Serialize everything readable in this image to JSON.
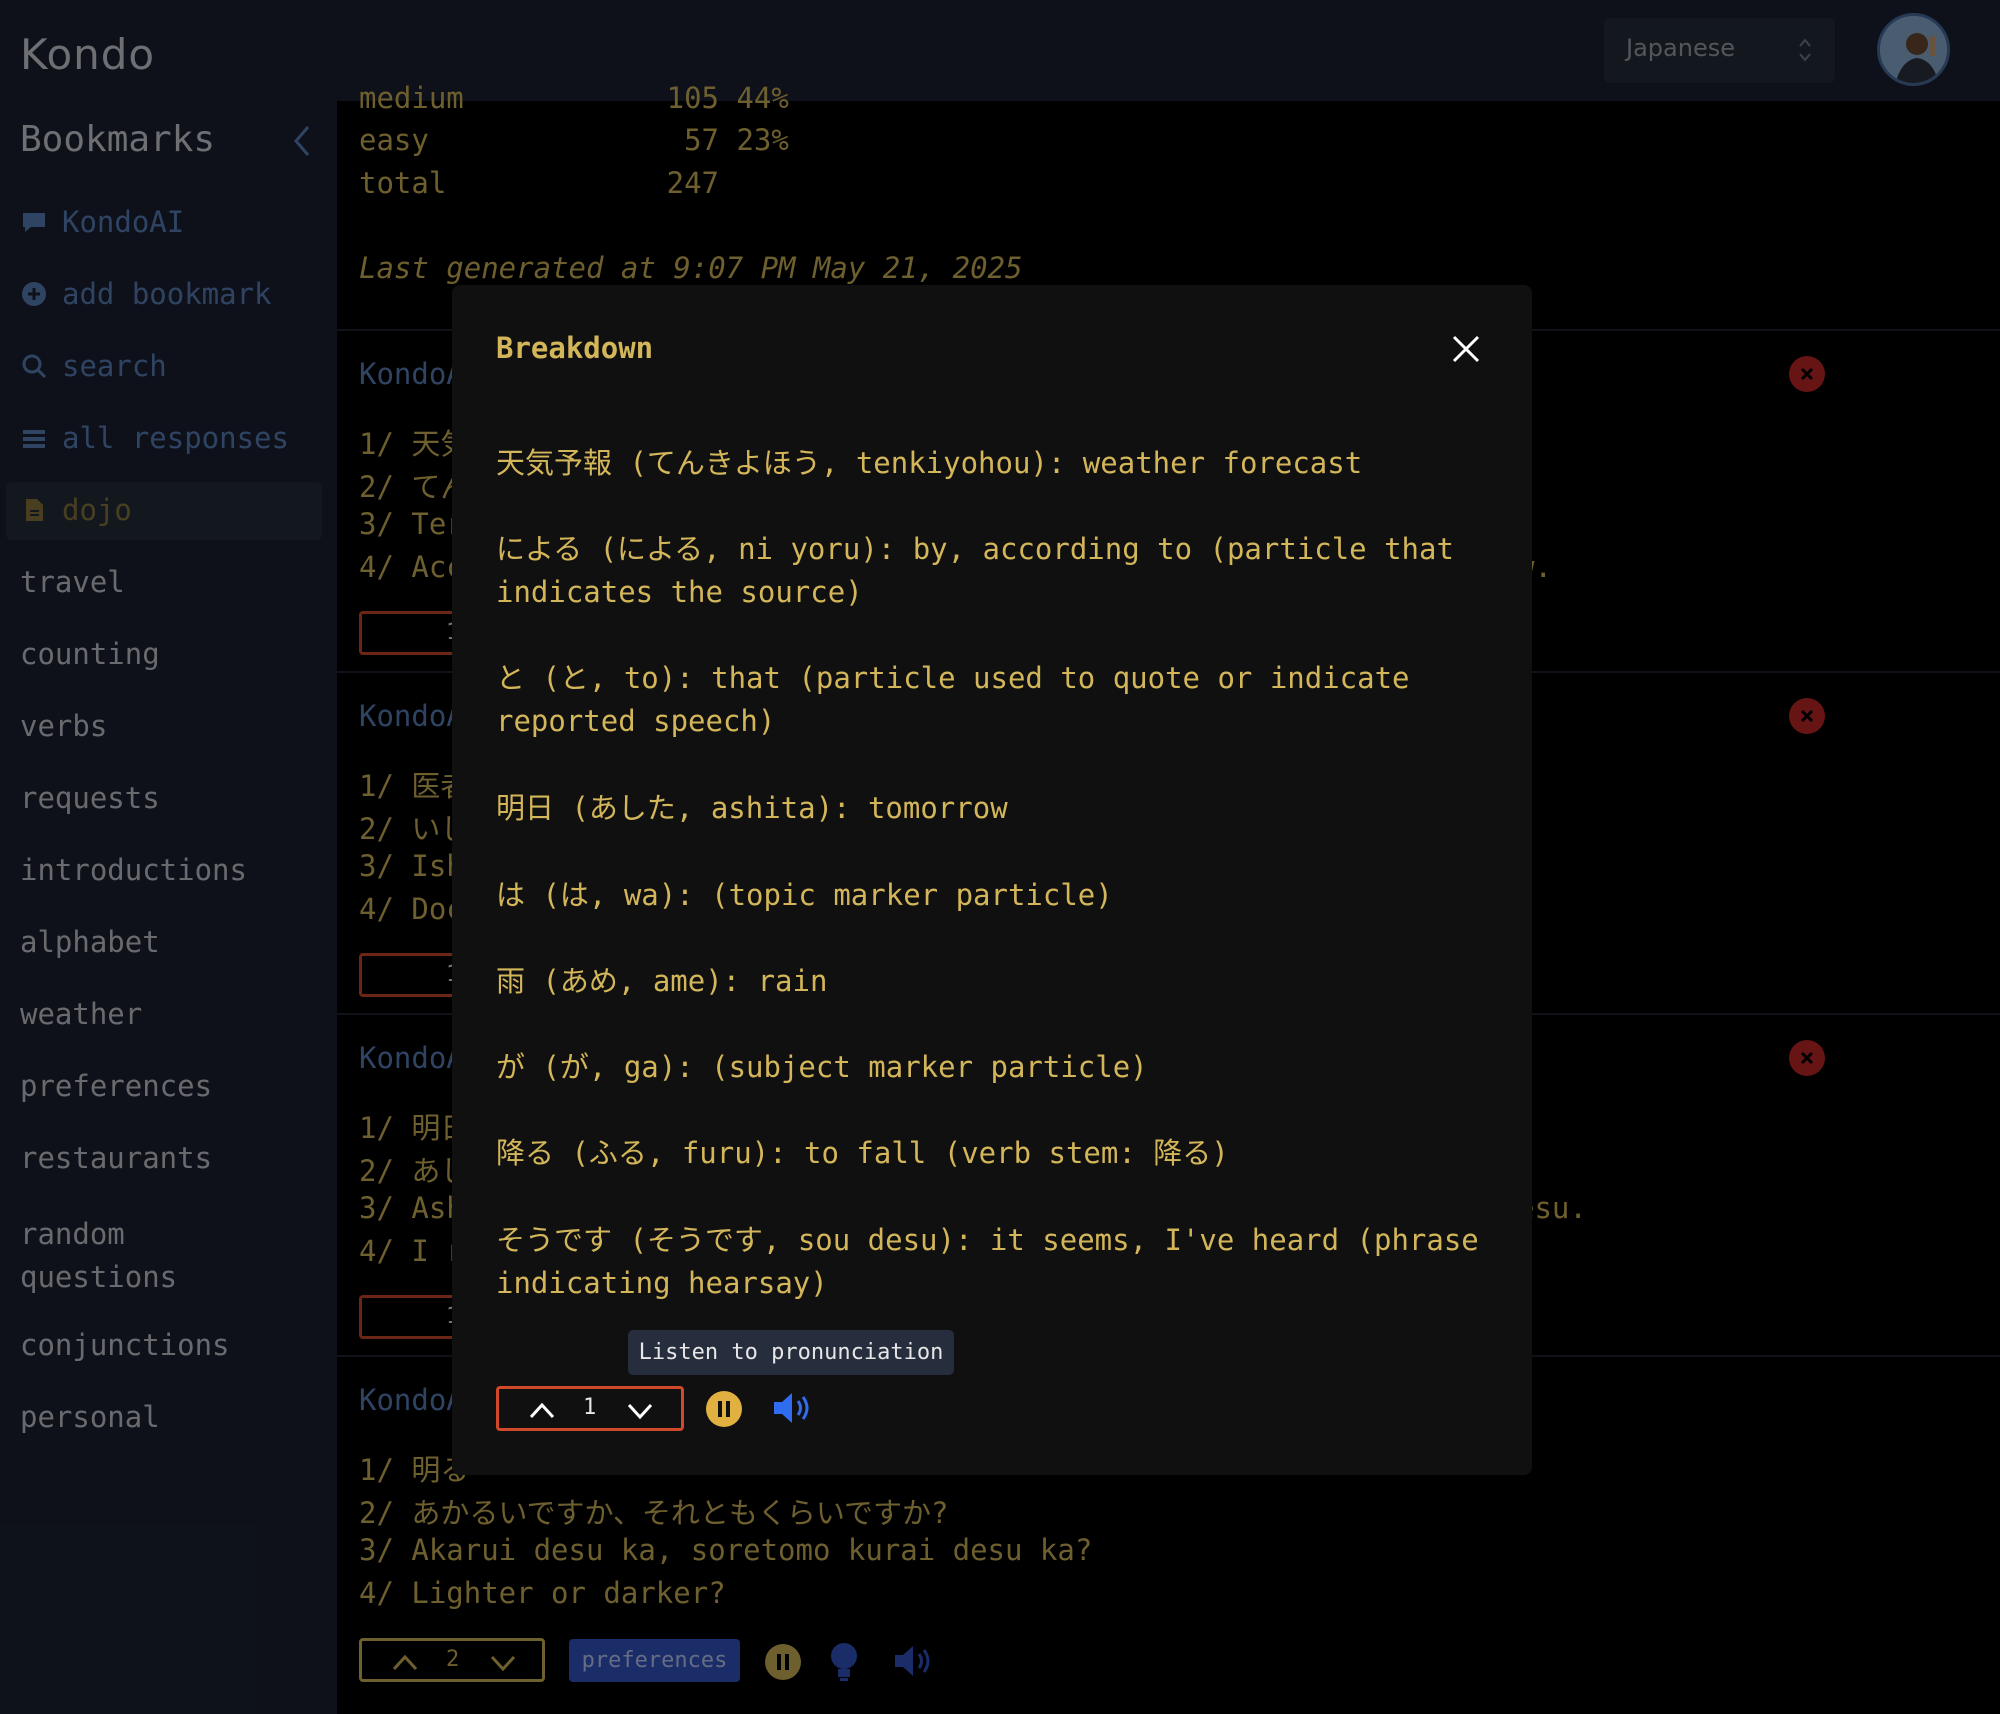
{
  "app": {
    "title": "Kondo"
  },
  "header": {
    "language": "Japanese"
  },
  "sidebar": {
    "heading": "Bookmarks",
    "items": [
      {
        "label": "KondoAI",
        "icon": "chat-icon"
      },
      {
        "label": "add bookmark",
        "icon": "plus-circle-icon"
      },
      {
        "label": "search",
        "icon": "search-icon"
      },
      {
        "label": "all responses",
        "icon": "list-icon"
      },
      {
        "label": "dojo",
        "icon": "document-icon"
      },
      {
        "label": "travel"
      },
      {
        "label": "counting"
      },
      {
        "label": "verbs"
      },
      {
        "label": "requests"
      },
      {
        "label": "introductions"
      },
      {
        "label": "alphabet"
      },
      {
        "label": "weather"
      },
      {
        "label": "preferences"
      },
      {
        "label": "restaurants"
      },
      {
        "label": "random questions"
      },
      {
        "label": "conjunctions"
      },
      {
        "label": "personal"
      }
    ]
  },
  "stats": {
    "rows": [
      {
        "label": "medium",
        "count": "105",
        "pct": "44%"
      },
      {
        "label": "easy",
        "count": "57",
        "pct": "23%"
      },
      {
        "label": "total",
        "count": "247",
        "pct": ""
      }
    ],
    "last_generated": "Last generated at 9:07 PM May 21, 2025"
  },
  "cards": [
    {
      "source": "KondoA",
      "lines": [
        "1/ 天気",
        "2/ てん",
        "3/ Ter",
        "4/ Acc"
      ],
      "tail": "w.",
      "count": "1"
    },
    {
      "source": "KondoA",
      "lines": [
        "1/ 医者",
        "2/ いし",
        "3/ Ish",
        "4/ Doc"
      ],
      "tail": "",
      "count": "1"
    },
    {
      "source": "KondoA",
      "lines": [
        "1/ 明日",
        "2/ あし",
        "3/ Ash",
        "4/ I r"
      ],
      "tail": "esu.",
      "count": "1"
    },
    {
      "source": "KondoA",
      "lines": [
        "1/ 明る",
        "2/ あかるいですか、それともくらいですか?",
        "3/ Akarui desu ka, soretomo kurai desu ka?",
        "4/ Lighter or darker?"
      ],
      "tail": "",
      "count": "2",
      "tag": "preferences"
    }
  ],
  "modal": {
    "title": "Breakdown",
    "entries": [
      "天気予報 (てんきよほう, tenkiyohou): weather forecast",
      "による (による, ni yoru): by, according to (particle that indicates the source)",
      "と (と, to): that (particle used to quote or indicate reported speech)",
      "明日 (あした, ashita): tomorrow",
      "は (は, wa): (topic marker particle)",
      "雨 (あめ, ame): rain",
      "が (が, ga): (subject marker particle)",
      "降る (ふる, furu): to fall (verb stem: 降る)",
      "そうです (そうです, sou desu): it seems, I've heard (phrase indicating hearsay)"
    ],
    "tooltip": "Listen to pronunciation",
    "count": "1"
  },
  "colors": {
    "accent": "#d4b65a",
    "link": "#5b82bf",
    "danger": "#c62828",
    "stepper_border": "#d0492a",
    "sidebar_bg": "#1b2231"
  }
}
